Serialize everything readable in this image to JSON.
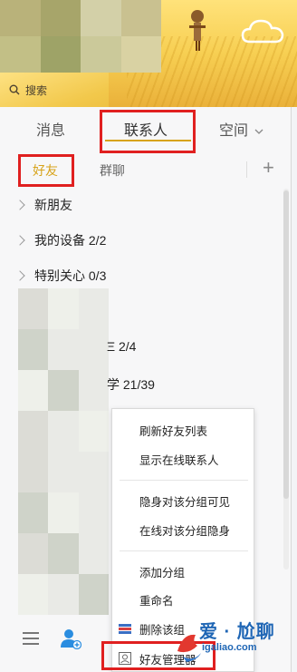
{
  "search": {
    "placeholder": "搜索"
  },
  "tabs": [
    {
      "label": "消息"
    },
    {
      "label": "联系人"
    },
    {
      "label": "空间"
    }
  ],
  "subtabs": {
    "friends": "好友",
    "groups": "群聊"
  },
  "groups": [
    {
      "label": "新朋友"
    },
    {
      "label": "我的设备 2/2"
    },
    {
      "label": "特别关心 0/3"
    }
  ],
  "partial_rows": [
    "Ξ 2/4",
    "学 21/39"
  ],
  "context_menu": {
    "items": [
      "刷新好友列表",
      "显示在线联系人",
      "隐身对该分组可见",
      "在线对该分组隐身",
      "添加分组",
      "重命名",
      "删除该组",
      "好友管理器"
    ]
  },
  "watermark": {
    "title": "爱 · 尬聊",
    "url": "igaliao.com"
  },
  "colors": {
    "accent": "#d7a31a",
    "highlight": "#e02020",
    "watermark": "#1f66b5"
  }
}
